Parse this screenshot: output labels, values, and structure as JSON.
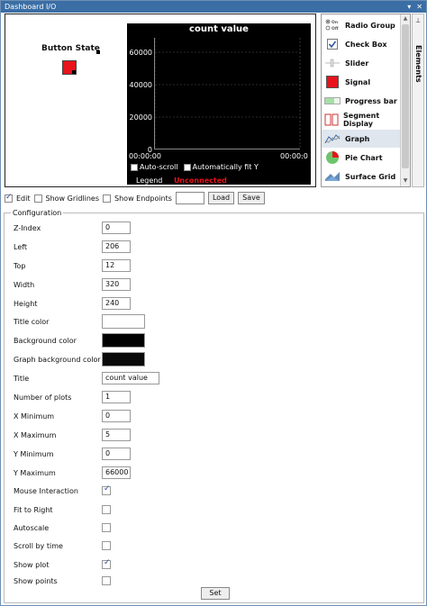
{
  "window": {
    "title": "Dashboard I/O",
    "controls": [
      "▾",
      "✕"
    ]
  },
  "canvas": {
    "button_state_label": "Button State",
    "graph": {
      "title": "count value",
      "y_ticks": [
        "60000",
        "40000",
        "20000",
        "0"
      ],
      "x_ticks": [
        "00:00:00",
        "00:00:0"
      ],
      "autoscroll_label": "Auto-scroll",
      "autofit_label": "Automatically fit Y",
      "legend_label": "Legend",
      "status": "Unconnected"
    }
  },
  "elements_panel": {
    "tab_label": "Elements",
    "items": [
      {
        "label": "Radio Group",
        "icon": "radio-group-icon",
        "sub": [
          "On",
          "Off"
        ]
      },
      {
        "label": "Check Box",
        "icon": "checkbox-icon"
      },
      {
        "label": "Slider",
        "icon": "slider-icon"
      },
      {
        "label": "Signal",
        "icon": "signal-icon"
      },
      {
        "label": "Progress bar",
        "icon": "progress-bar-icon"
      },
      {
        "label": "Segment Display",
        "icon": "segment-display-icon"
      },
      {
        "label": "Graph",
        "icon": "graph-icon"
      },
      {
        "label": "Pie Chart",
        "icon": "pie-chart-icon"
      },
      {
        "label": "Surface Grid",
        "icon": "surface-grid-icon"
      }
    ]
  },
  "toolbar": {
    "edit_label": "Edit",
    "gridlines_label": "Show Gridlines",
    "endpoints_label": "Show Endpoints",
    "load_label": "Load",
    "save_label": "Save"
  },
  "config": {
    "legend": "Configuration",
    "fields": [
      {
        "label": "Z-Index",
        "value": "0"
      },
      {
        "label": "Left",
        "value": "206"
      },
      {
        "label": "Top",
        "value": "12"
      },
      {
        "label": "Width",
        "value": "320"
      },
      {
        "label": "Height",
        "value": "240"
      }
    ],
    "color_fields": [
      {
        "label": "Title color",
        "value": "#ffffff"
      },
      {
        "label": "Background color",
        "value": "#000000"
      },
      {
        "label": "Graph background color",
        "value": "#0a0a0a"
      }
    ],
    "title_label": "Title",
    "title_value": "count value",
    "num_fields": [
      {
        "label": "Number of plots",
        "value": "1"
      },
      {
        "label": "X Minimum",
        "value": "0"
      },
      {
        "label": "X Maximum",
        "value": "5"
      },
      {
        "label": "Y Minimum",
        "value": "0"
      },
      {
        "label": "Y Maximum",
        "value": "66000"
      }
    ],
    "checks": [
      {
        "label": "Mouse Interaction",
        "checked": true
      },
      {
        "label": "Fit to Right",
        "checked": false
      },
      {
        "label": "Autoscale",
        "checked": false
      },
      {
        "label": "Scroll by time",
        "checked": false
      },
      {
        "label": "Show plot",
        "checked": true
      },
      {
        "label": "Show points",
        "checked": false
      }
    ],
    "set_label": "Set"
  },
  "colors": {
    "titlebar": "#3a6ea5",
    "signal": "#e8131b",
    "unconnected": "#e8131b"
  }
}
